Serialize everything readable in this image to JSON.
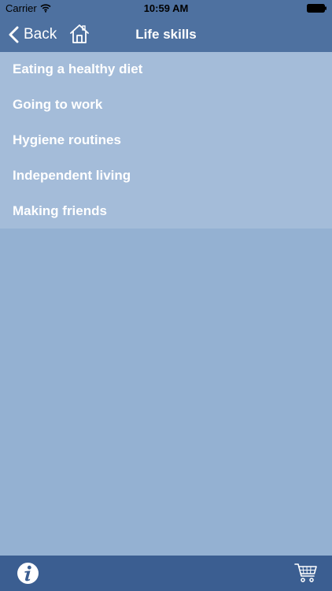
{
  "status_bar": {
    "carrier": "Carrier",
    "time": "10:59 AM"
  },
  "nav": {
    "back_label": "Back",
    "title": "Life skills"
  },
  "menu": {
    "items": [
      {
        "label": "Eating a healthy diet"
      },
      {
        "label": "Going to work"
      },
      {
        "label": "Hygiene routines"
      },
      {
        "label": "Independent living"
      },
      {
        "label": "Making friends"
      }
    ]
  },
  "colors": {
    "nav_bar": "#4e71a0",
    "list_background": "#a4bcd9",
    "page_background": "#94b1d2",
    "bottom_bar": "#3b5e91",
    "text": "#ffffff"
  },
  "icons": {
    "back": "chevron-left-icon",
    "home": "home-icon",
    "info": "info-icon",
    "cart": "shopping-cart-icon",
    "wifi": "wifi-icon",
    "battery": "battery-icon"
  }
}
